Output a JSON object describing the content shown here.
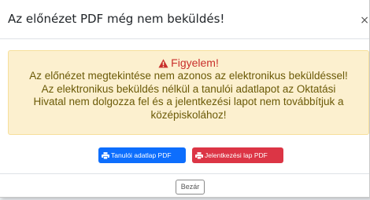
{
  "modal": {
    "title": "Az előnézet PDF még nem beküldés!",
    "close_symbol": "×"
  },
  "alert": {
    "heading": "Figyelem!",
    "lines": [
      "Az előnézet megtekintése nem azonos az elektronikus beküldéssel!",
      "Az elektronikus beküldés nélkül a tanulói adatlapot az Oktatási",
      "Hivatal nem dolgozza fel és a jelentkezési lapot nem továbbítjuk a",
      "középiskolához!"
    ],
    "icon": "warning-triangle-icon"
  },
  "buttons": {
    "student_pdf": "Tanulói adatlap PDF",
    "application_pdf": "Jelentkezési lap PDF",
    "close": "Bezár"
  },
  "colors": {
    "primary": "#0d6efd",
    "danger": "#dc3545",
    "alert_bg": "#fcf0cf",
    "alert_heading": "#c9302c"
  }
}
